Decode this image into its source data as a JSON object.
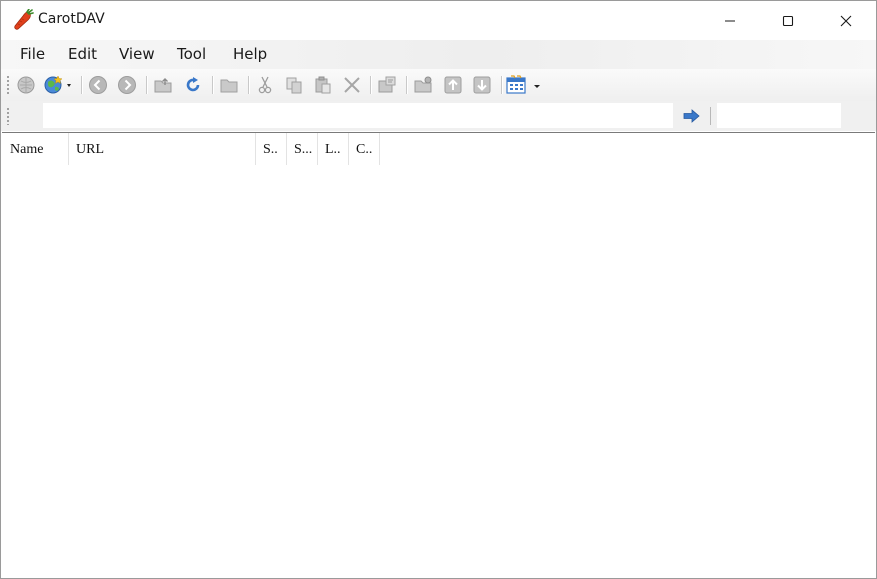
{
  "window": {
    "title": "CarotDAV",
    "app_icon": "carrot-icon",
    "controls": [
      "minimize-icon",
      "maximize-icon",
      "close-icon"
    ]
  },
  "menubar": {
    "items": [
      {
        "label": "File"
      },
      {
        "label": "Edit"
      },
      {
        "label": "View"
      },
      {
        "label": "Tool"
      },
      {
        "label": "Help"
      }
    ]
  },
  "toolbar": {
    "buttons": [
      "connect-icon",
      "favorite-globe-icon",
      "back-icon",
      "forward-icon",
      "parent-folder-icon",
      "refresh-icon",
      "new-folder-icon",
      "cut-icon",
      "copy-icon",
      "paste-icon",
      "delete-icon",
      "properties-icon",
      "folder-settings-icon",
      "upload-icon",
      "download-icon",
      "view-mode-icon"
    ]
  },
  "addressbar": {
    "value": "",
    "go_icon": "go-arrow-icon"
  },
  "list": {
    "columns": [
      {
        "label": "Name"
      },
      {
        "label": "URL"
      },
      {
        "label": "S.."
      },
      {
        "label": "S..."
      },
      {
        "label": "L.."
      },
      {
        "label": "C.."
      }
    ]
  },
  "colors": {
    "accent": "#3a78c9",
    "carrot": "#e0401c"
  }
}
